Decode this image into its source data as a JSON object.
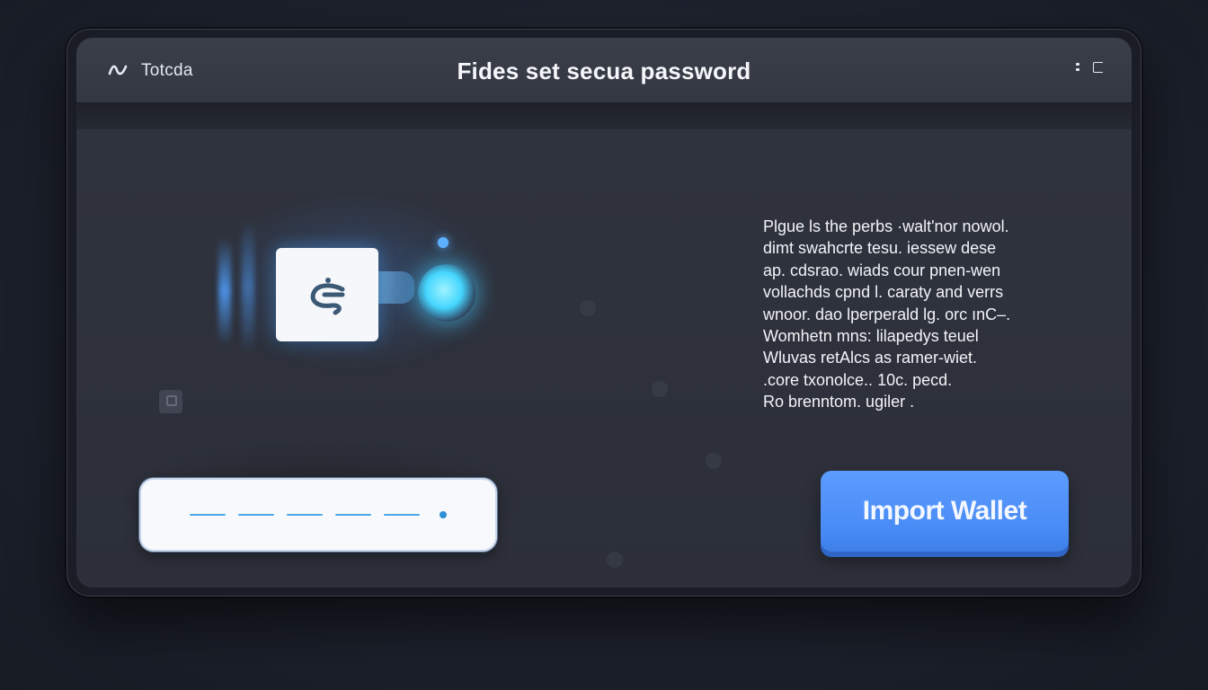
{
  "titlebar": {
    "app_icon": "wallet-logo-icon",
    "app_name": "Totcda",
    "title": "Fides set secua password",
    "controls": [
      "more-icon",
      "restore-icon"
    ]
  },
  "illustration": {
    "logo_icon": "wallet-key-logo-icon",
    "accent": "#4aa8ff",
    "bulb_color": "#45d6ff"
  },
  "password_field": {
    "value_masked": "— — — — — •",
    "accent": "#4aa8e8"
  },
  "description": {
    "lines": [
      "Plgue ls the perbs ·walt'nor nowol.",
      "dimt swahcrte tesu. iessew dese",
      "ap. cdsrao. wiads cour pnen-wen",
      "vollachds cpnd l. caraty and verrs",
      "wnoor. dao lperperald lg. orc ınC–.",
      "Womhetn mns: lilapedys teuel",
      "Wluvas retAlcs as ramer-wiet.",
      ".core txonolce.. 10c. pecd.",
      "Ro brenntom. ugiler ."
    ]
  },
  "import_button": {
    "label": "Import Wallet",
    "color": "#4a8cf6"
  },
  "colors": {
    "background": "#1d212c",
    "panel": "#2e323c",
    "titlebar": "#373b46"
  }
}
